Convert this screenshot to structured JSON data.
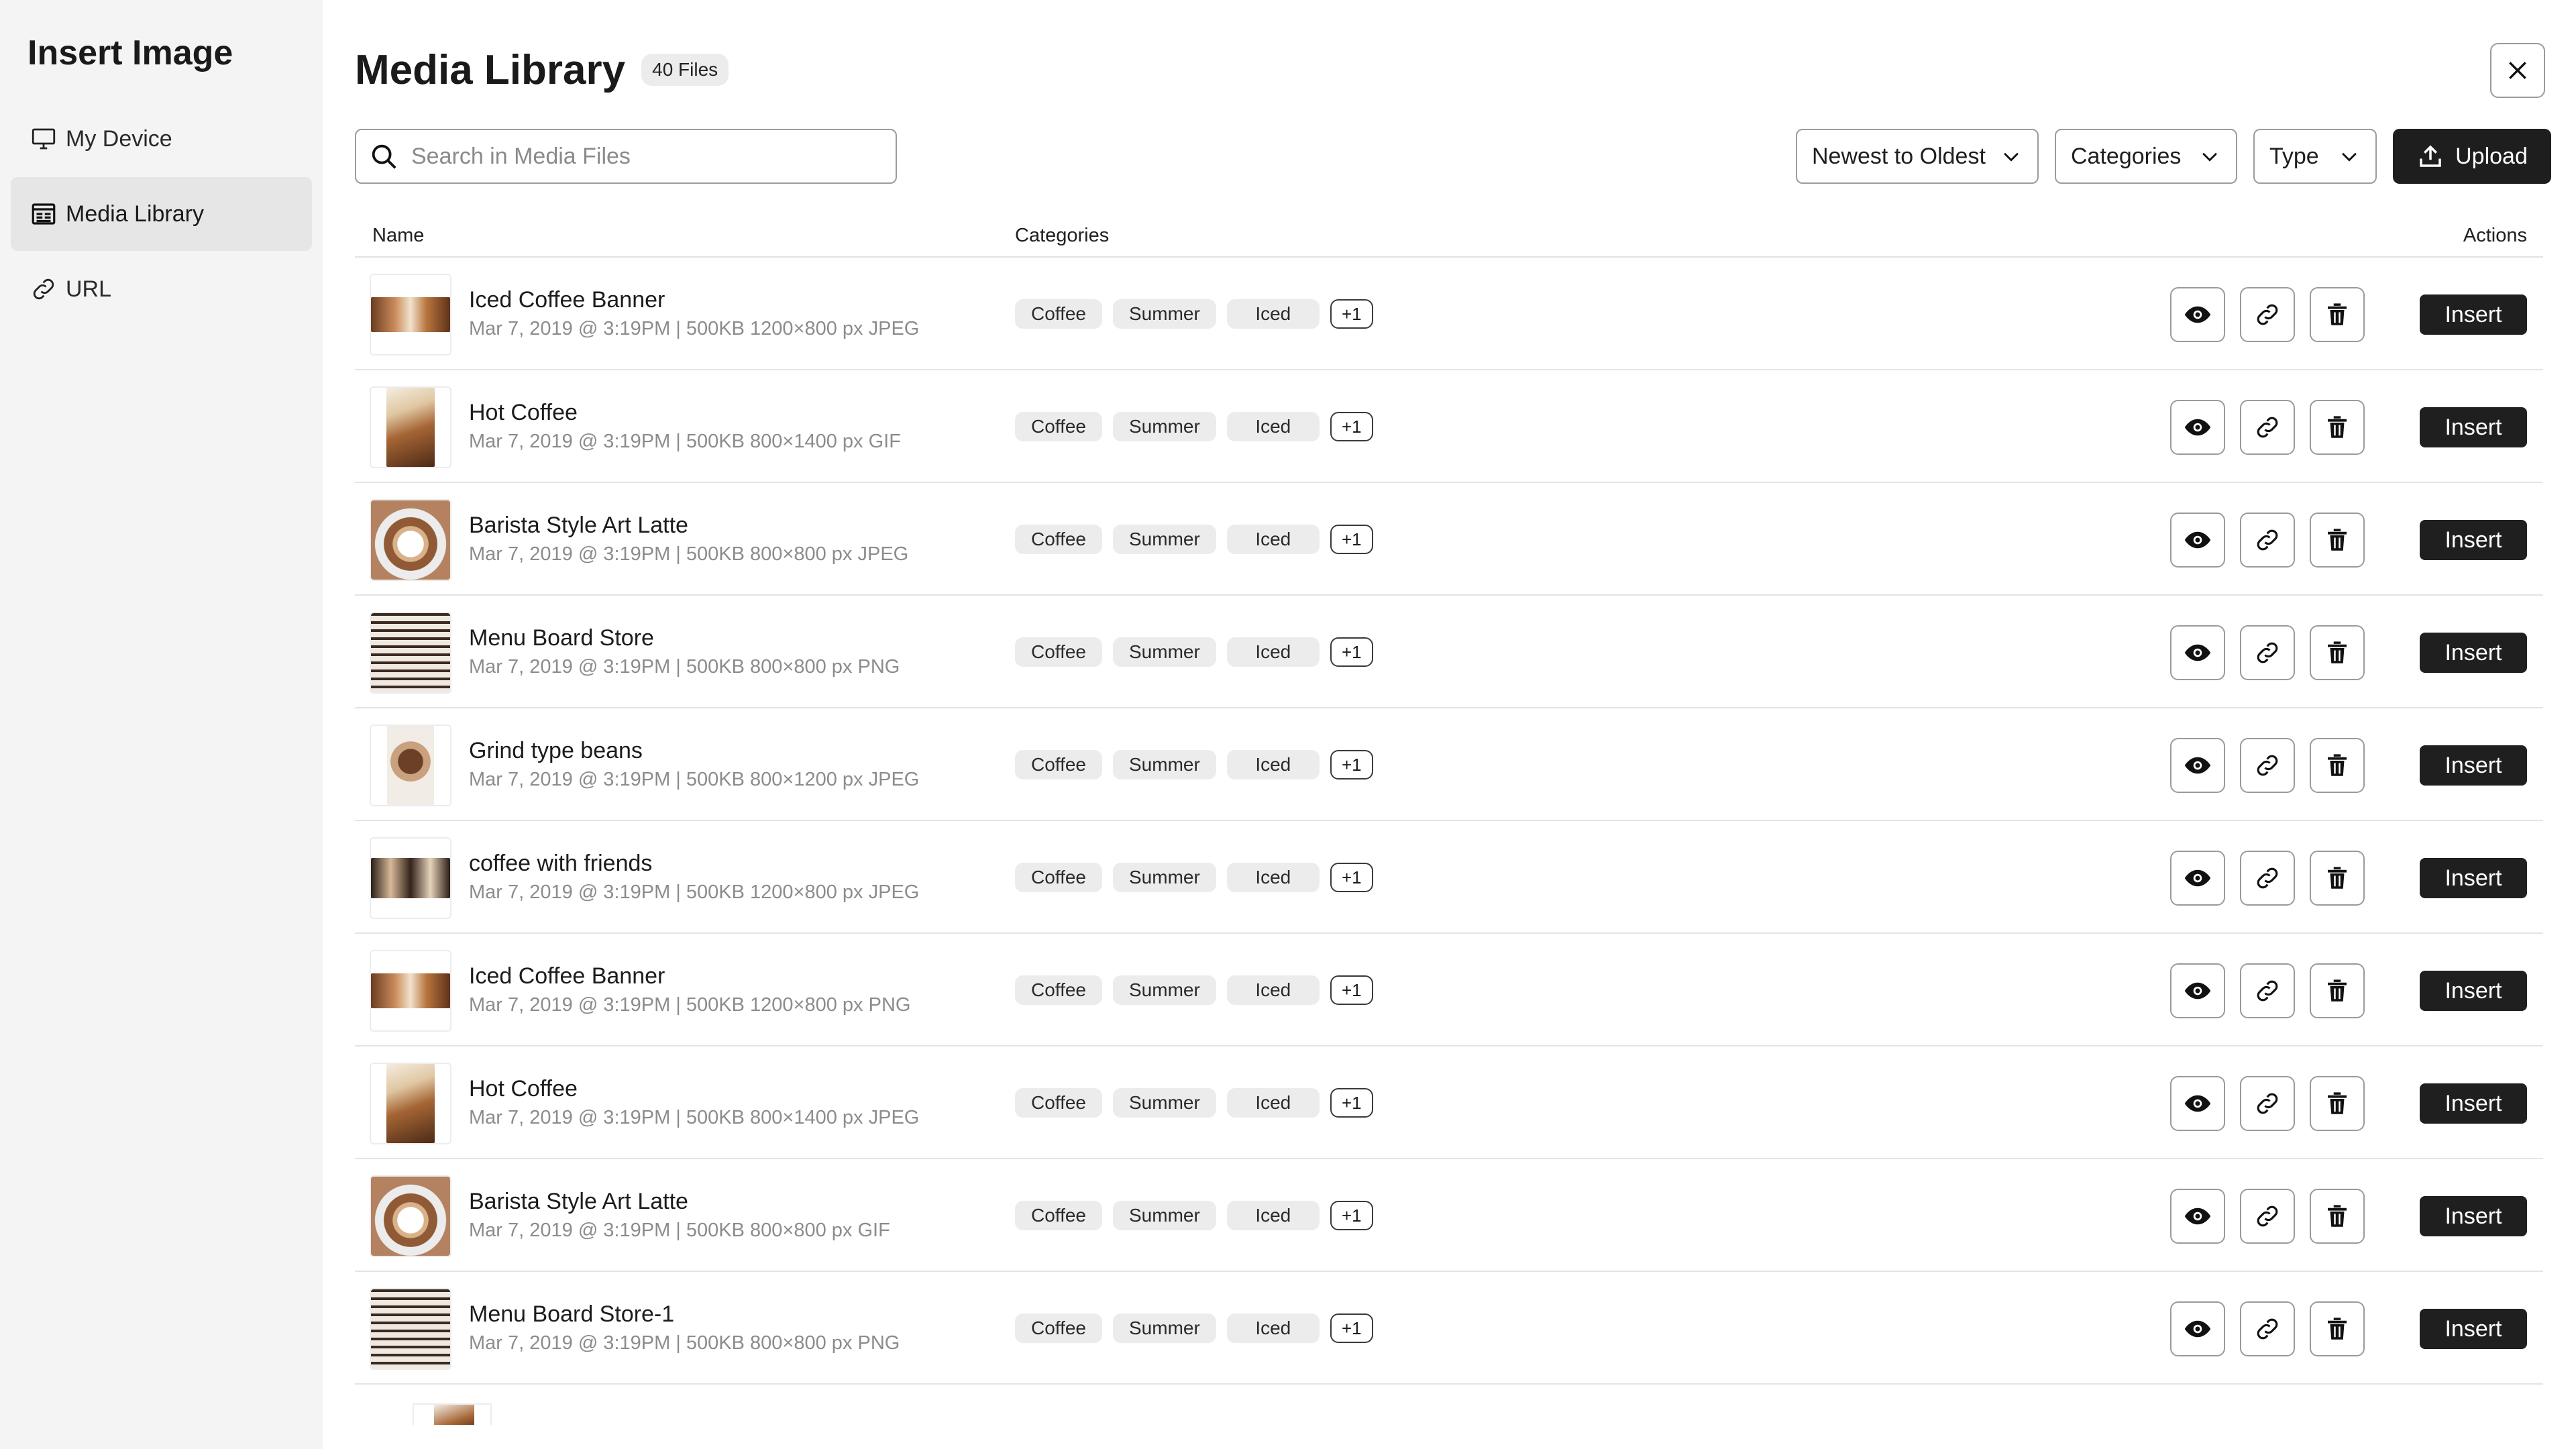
{
  "sidebar": {
    "title": "Insert Image",
    "items": [
      {
        "label": "My Device",
        "icon": "monitor-icon"
      },
      {
        "label": "Media Library",
        "icon": "library-icon",
        "active": true
      },
      {
        "label": "URL",
        "icon": "link-icon"
      }
    ]
  },
  "header": {
    "title": "Media Library",
    "file_count": "40 Files",
    "close_icon": "close-icon"
  },
  "search": {
    "placeholder": "Search in Media Files",
    "value": ""
  },
  "filters": {
    "sort": "Newest to Oldest",
    "categories": "Categories",
    "type": "Type",
    "upload": "Upload"
  },
  "table": {
    "columns": {
      "name": "Name",
      "categories": "Categories",
      "actions": "Actions"
    },
    "tag_labels": [
      "Coffee",
      "Summer",
      "Iced",
      "+1"
    ],
    "insert_label": "Insert",
    "rows": [
      {
        "name": "Iced Coffee Banner",
        "meta": "Mar 7, 2019 @ 3:19PM | 500KB 1200×800 px JPEG",
        "thumb": "banner"
      },
      {
        "name": "Hot Coffee",
        "meta": "Mar 7, 2019 @ 3:19PM | 500KB 800×1400 px GIF",
        "thumb": "tall"
      },
      {
        "name": "Barista Style Art Latte",
        "meta": "Mar 7, 2019 @ 3:19PM | 500KB 800×800 px JPEG",
        "thumb": "latte"
      },
      {
        "name": "Menu Board Store",
        "meta": "Mar 7, 2019 @ 3:19PM | 500KB 800×800 px PNG",
        "thumb": "menu"
      },
      {
        "name": "Grind type beans",
        "meta": "Mar 7, 2019 @ 3:19PM | 500KB 800×1200 px JPEG",
        "thumb": "beans"
      },
      {
        "name": "coffee with friends",
        "meta": "Mar 7, 2019 @ 3:19PM | 500KB 1200×800 px JPEG",
        "thumb": "friends"
      },
      {
        "name": "Iced Coffee Banner",
        "meta": "Mar 7, 2019 @ 3:19PM | 500KB 1200×800 px PNG",
        "thumb": "banner"
      },
      {
        "name": "Hot Coffee",
        "meta": "Mar 7, 2019 @ 3:19PM | 500KB 800×1400 px JPEG",
        "thumb": "tall"
      },
      {
        "name": "Barista Style Art Latte",
        "meta": "Mar 7, 2019 @ 3:19PM | 500KB 800×800 px GIF",
        "thumb": "latte"
      },
      {
        "name": "Menu Board Store-1",
        "meta": "Mar 7, 2019 @ 3:19PM | 500KB 800×800 px PNG",
        "thumb": "menu"
      }
    ]
  },
  "action_icons": [
    "eye-icon",
    "link-icon",
    "trash-icon"
  ]
}
